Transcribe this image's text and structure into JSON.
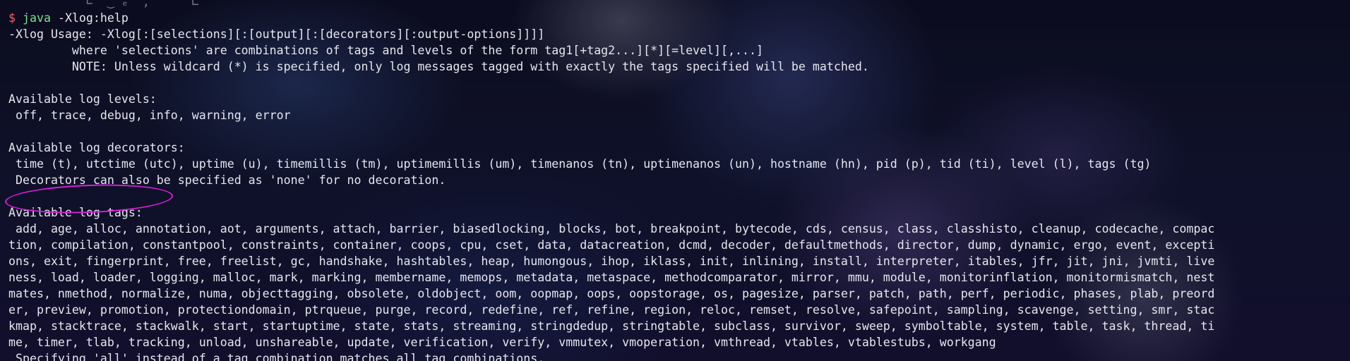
{
  "terminal": {
    "lines": [
      "",
      "",
      "-Xlog Usage: -Xlog[:[selections][:[output][:[decorators][:output-options]]]]",
      "         where 'selections' are combinations of tags and levels of the form tag1[+tag2...][*][=level][,...]",
      "         NOTE: Unless wildcard (*) is specified, only log messages tagged with exactly the tags specified will be matched.",
      "",
      "Available log levels:",
      " off, trace, debug, info, warning, error",
      "",
      "Available log decorators:",
      " time (t), utctime (utc), uptime (u), timemillis (tm), uptimemillis (um), timenanos (tn), uptimenanos (un), hostname (hn), pid (p), tid (ti), level (l), tags (tg)",
      " Decorators can also be specified as 'none' for no decoration.",
      "",
      "Available log tags:",
      " add, age, alloc, annotation, aot, arguments, attach, barrier, biasedlocking, blocks, bot, breakpoint, bytecode, cds, census, class, classhisto, cleanup, codecache, compac",
      "tion, compilation, constantpool, constraints, container, coops, cpu, cset, data, datacreation, dcmd, decoder, defaultmethods, director, dump, dynamic, ergo, event, excepti",
      "ons, exit, fingerprint, free, freelist, gc, handshake, hashtables, heap, humongous, ihop, iklass, init, inlining, install, interpreter, itables, jfr, jit, jni, jvmti, live",
      "ness, load, loader, logging, malloc, mark, marking, membername, memops, metadata, metaspace, methodcomparator, mirror, mmu, module, monitorinflation, monitormismatch, nest",
      "mates, nmethod, normalize, numa, objecttagging, obsolete, oldobject, oom, oopmap, oops, oopstorage, os, pagesize, parser, patch, path, perf, periodic, phases, plab, preord",
      "er, preview, promotion, protectiondomain, ptrqueue, purge, record, redefine, ref, refine, region, reloc, remset, resolve, safepoint, sampling, scavenge, setting, smr, stac",
      "kmap, stacktrace, stackwalk, start, startuptime, state, stats, streaming, stringdedup, stringtable, subclass, survivor, sweep, symboltable, system, table, task, thread, ti",
      "me, timer, tlab, tracking, unload, unshareable, update, verification, verify, vmmutex, vmoperation, vmthread, vtables, vtablestubs, workgang",
      " Specifying 'all' instead of a tag combination matches all tag combinations."
    ],
    "ghost_line": "           ∟  ‿ ₑ  ,      ⊏",
    "prompt": {
      "symbol": "$",
      "command": "java",
      "args": " -Xlog:help"
    }
  },
  "colors": {
    "prompt_symbol": "#ff5f6d",
    "command": "#7fe08a",
    "text": "#e6e6ee",
    "annotation_ellipse": "#d81fd6"
  }
}
